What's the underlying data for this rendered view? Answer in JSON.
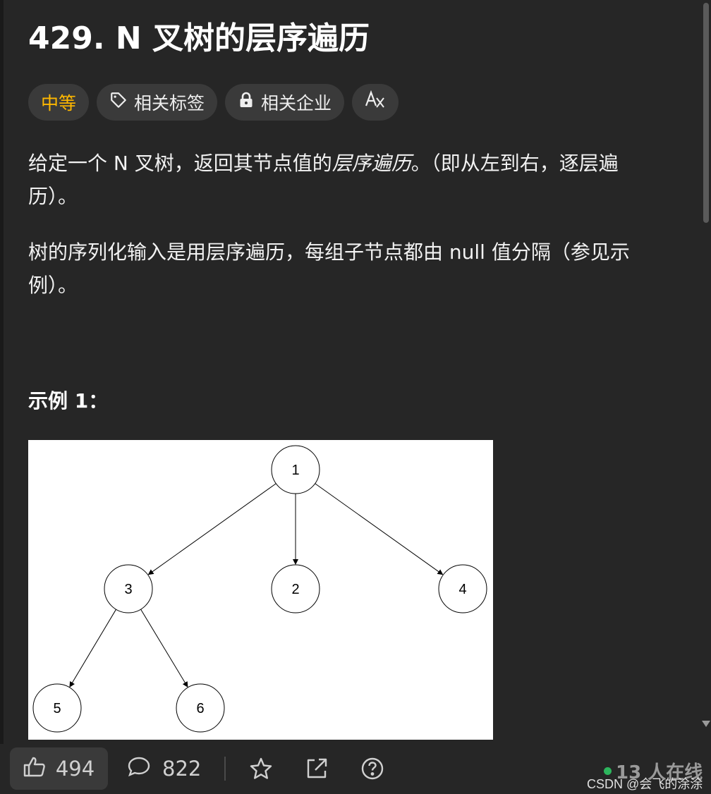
{
  "problem": {
    "title": "429. N 叉树的层序遍历",
    "tags": {
      "difficulty": "中等",
      "related_tags": "相关标签",
      "related_companies": "相关企业"
    },
    "description": {
      "p1_before": "给定一个 N 叉树，返回其节点值的",
      "p1_em": "层序遍历",
      "p1_after": "。（即从左到右，逐层遍历）。",
      "p2": "树的序列化输入是用层序遍历，每组子节点都由 null 值分隔（参见示例）。"
    },
    "example_title": "示例 1："
  },
  "tree": {
    "nodes": [
      {
        "id": "1",
        "label": "1"
      },
      {
        "id": "3",
        "label": "3"
      },
      {
        "id": "2",
        "label": "2"
      },
      {
        "id": "4",
        "label": "4"
      },
      {
        "id": "5",
        "label": "5"
      },
      {
        "id": "6",
        "label": "6"
      }
    ],
    "edges": [
      [
        "1",
        "3"
      ],
      [
        "1",
        "2"
      ],
      [
        "1",
        "4"
      ],
      [
        "3",
        "5"
      ],
      [
        "3",
        "6"
      ]
    ]
  },
  "bottom_bar": {
    "likes": "494",
    "comments": "822",
    "online": "13 人在线"
  },
  "watermark": "CSDN @会飞的涂涂",
  "colors": {
    "background": "#262626",
    "difficulty": "#ffb800",
    "online_dot": "#2db55d"
  },
  "icons": [
    "tag-icon",
    "lock-icon",
    "translate-icon",
    "thumbs-up-icon",
    "comment-icon",
    "star-icon",
    "share-icon",
    "help-icon"
  ]
}
